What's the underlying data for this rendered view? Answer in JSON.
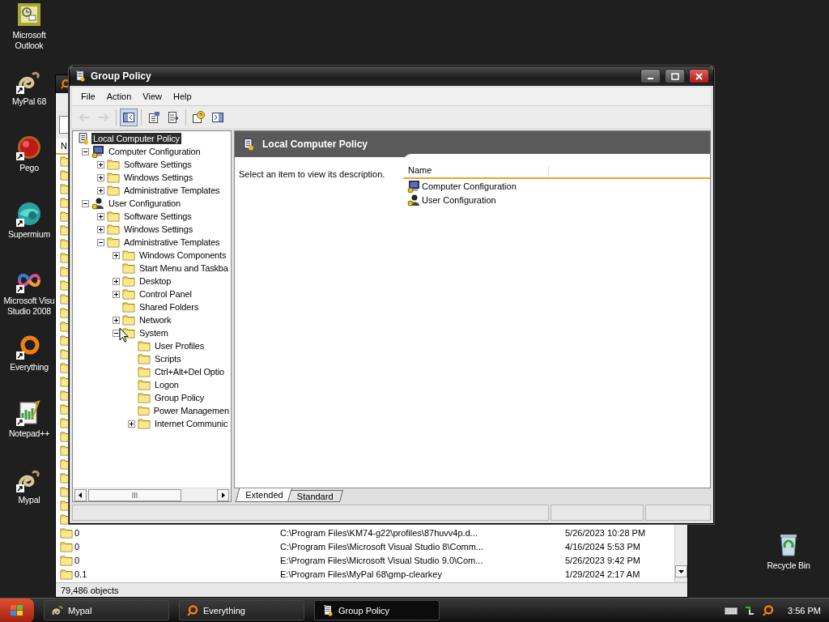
{
  "desktop_icons": [
    {
      "kind": "outlook",
      "label": "Microsoft Outlook",
      "shortcut": false
    },
    {
      "kind": "mypal",
      "label": "MyPal 68",
      "shortcut": true
    },
    {
      "kind": "pego",
      "label": "Pego",
      "shortcut": true
    },
    {
      "kind": "supermium",
      "label": "Supermium",
      "shortcut": true
    },
    {
      "kind": "vs",
      "label": "Microsoft Visu Studio 2008",
      "shortcut": true
    },
    {
      "kind": "everything",
      "label": "Everything",
      "shortcut": true
    },
    {
      "kind": "notepad",
      "label": "Notepad++",
      "shortcut": true
    },
    {
      "kind": "mypal",
      "label": "Mypal",
      "shortcut": true
    }
  ],
  "recycle_bin": {
    "label": "Recycle Bin"
  },
  "background_window": {
    "column_header": "N",
    "rows": [
      {
        "name": "0",
        "path": "C:\\Program Files\\KM74-g22\\profiles\\87huvv4p.d...",
        "modified": "5/26/2023 10:28 PM"
      },
      {
        "name": "0",
        "path": "C:\\Program Files\\Microsoft Visual Studio 8\\Comm...",
        "modified": "4/16/2024 5:53 PM"
      },
      {
        "name": "0",
        "path": "E:\\Program Files\\Microsoft Visual Studio 9.0\\Com...",
        "modified": "5/26/2023 9:42 PM"
      },
      {
        "name": "0.1",
        "path": "E:\\Program Files\\MyPal 68\\gmp-clearkey",
        "modified": "1/29/2024 2:17 AM"
      }
    ],
    "status": "79,486 objects"
  },
  "window": {
    "title": "Group Policy",
    "menu": [
      "File",
      "Action",
      "View",
      "Help"
    ],
    "toolbar": [
      {
        "kind": "back",
        "disabled": true,
        "pressed": false
      },
      {
        "kind": "forward",
        "disabled": true,
        "pressed": false
      },
      {
        "kind": "tree",
        "disabled": false,
        "pressed": true
      },
      {
        "kind": "properties",
        "disabled": false,
        "pressed": false
      },
      {
        "kind": "export",
        "disabled": false,
        "pressed": false
      },
      {
        "kind": "help",
        "disabled": false,
        "pressed": false
      },
      {
        "kind": "actionpane",
        "disabled": false,
        "pressed": false
      }
    ],
    "tree": [
      {
        "kind": "policy",
        "label": "Local Computer Policy",
        "expandable": false,
        "selected": true,
        "children": [
          {
            "kind": "computer",
            "label": "Computer Configuration",
            "expandable": true,
            "expanded": true,
            "selected": false,
            "children": [
              {
                "kind": "folder",
                "label": "Software Settings",
                "expandable": true,
                "expanded": false,
                "selected": false
              },
              {
                "kind": "folder",
                "label": "Windows Settings",
                "expandable": true,
                "expanded": false,
                "selected": false
              },
              {
                "kind": "folder",
                "label": "Administrative Templates",
                "expandable": true,
                "expanded": false,
                "selected": false
              }
            ]
          },
          {
            "kind": "user",
            "label": "User Configuration",
            "expandable": true,
            "expanded": true,
            "selected": false,
            "children": [
              {
                "kind": "folder",
                "label": "Software Settings",
                "expandable": true,
                "expanded": false,
                "selected": false
              },
              {
                "kind": "folder",
                "label": "Windows Settings",
                "expandable": true,
                "expanded": false,
                "selected": false
              },
              {
                "kind": "folder",
                "label": "Administrative Templates",
                "expandable": true,
                "expanded": true,
                "selected": false,
                "children": [
                  {
                    "kind": "folder",
                    "label": "Windows Components",
                    "expandable": true,
                    "expanded": false,
                    "selected": false
                  },
                  {
                    "kind": "folder",
                    "label": "Start Menu and Taskba",
                    "expandable": false,
                    "selected": false
                  },
                  {
                    "kind": "folder",
                    "label": "Desktop",
                    "expandable": true,
                    "expanded": false,
                    "selected": false
                  },
                  {
                    "kind": "folder",
                    "label": "Control Panel",
                    "expandable": true,
                    "expanded": false,
                    "selected": false
                  },
                  {
                    "kind": "folder",
                    "label": "Shared Folders",
                    "expandable": false,
                    "selected": false
                  },
                  {
                    "kind": "folder",
                    "label": "Network",
                    "expandable": true,
                    "expanded": false,
                    "selected": false
                  },
                  {
                    "kind": "folder",
                    "label": "System",
                    "expandable": true,
                    "expanded": true,
                    "selected": false,
                    "children": [
                      {
                        "kind": "folder",
                        "label": "User Profiles",
                        "expandable": false,
                        "selected": false
                      },
                      {
                        "kind": "folder",
                        "label": "Scripts",
                        "expandable": false,
                        "selected": false
                      },
                      {
                        "kind": "folder",
                        "label": "Ctrl+Alt+Del Optio",
                        "expandable": false,
                        "selected": false
                      },
                      {
                        "kind": "folder",
                        "label": "Logon",
                        "expandable": false,
                        "selected": false
                      },
                      {
                        "kind": "folder",
                        "label": "Group Policy",
                        "expandable": false,
                        "selected": false
                      },
                      {
                        "kind": "folder",
                        "label": "Power Managemen",
                        "expandable": false,
                        "selected": false
                      },
                      {
                        "kind": "folder",
                        "label": "Internet Communic",
                        "expandable": true,
                        "expanded": false,
                        "selected": false
                      }
                    ]
                  }
                ]
              }
            ]
          }
        ]
      }
    ],
    "details": {
      "title": "Local Computer Policy",
      "description": "Select an item to view its description.",
      "columns": [
        "Name"
      ],
      "rows": [
        {
          "kind": "computer",
          "name": "Computer Configuration"
        },
        {
          "kind": "user",
          "name": "User Configuration"
        }
      ]
    },
    "tabs": [
      {
        "label": "Extended",
        "selected": true
      },
      {
        "label": "Standard",
        "selected": false
      }
    ]
  },
  "taskbar": {
    "tasks": [
      {
        "kind": "mypal",
        "label": "Mypal",
        "selected": false
      },
      {
        "kind": "everything",
        "label": "Everything",
        "selected": false
      },
      {
        "kind": "policy",
        "label": "Group Policy",
        "selected": true
      }
    ],
    "tray": [
      {
        "kind": "keyboard"
      },
      {
        "kind": "update"
      },
      {
        "kind": "everything"
      }
    ],
    "clock": "3:56 PM"
  }
}
